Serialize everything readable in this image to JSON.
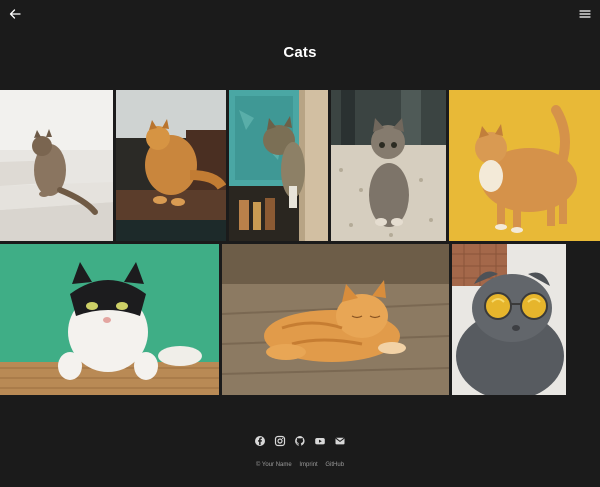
{
  "header": {
    "back_icon": "arrow-left-icon",
    "menu_icon": "hamburger-menu-icon"
  },
  "page": {
    "title": "Cats"
  },
  "gallery": {
    "photos": [
      {
        "id": "photo-tabby-on-stairs",
        "subject": "tabby cat sitting on white stairs"
      },
      {
        "id": "photo-maine-coon-shelf",
        "subject": "orange long-haired cat on wooden shelf"
      },
      {
        "id": "photo-cat-peeking-teal-door",
        "subject": "tabby cat peeking behind teal door"
      },
      {
        "id": "photo-tabby-kitten-carpet",
        "subject": "tabby kitten sitting on carpet"
      },
      {
        "id": "photo-orange-cat-yellow-wall",
        "subject": "orange cat standing in front of yellow wall"
      },
      {
        "id": "photo-tuxedo-cat-green-wall",
        "subject": "black and white cat leaning on bamboo, green wall"
      },
      {
        "id": "photo-orange-cat-sleeping-floor",
        "subject": "orange cat sleeping on wooden floor"
      },
      {
        "id": "photo-grey-cat-sunglasses",
        "subject": "grey scottish fold cat wearing round sunglasses"
      }
    ]
  },
  "footer": {
    "social_icons": [
      "facebook-icon",
      "instagram-icon",
      "github-icon",
      "youtube-icon",
      "email-icon"
    ],
    "copyright": "© Your Name",
    "imprint_label": "Imprint",
    "github_label": "GitHub"
  },
  "colors": {
    "background": "#1b1b1b",
    "text": "#ffffff",
    "muted": "#9a9a9a"
  }
}
